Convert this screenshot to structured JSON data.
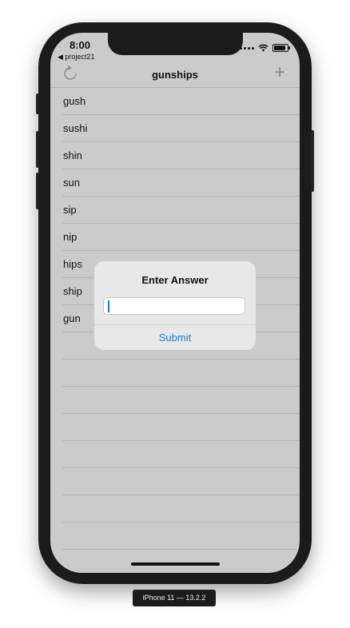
{
  "status": {
    "time": "8:00",
    "back_app": "◀ project21"
  },
  "navbar": {
    "title": "gunships",
    "refresh_icon": "refresh-icon",
    "add_label": "+"
  },
  "words": [
    "gush",
    "sushi",
    "shin",
    "sun",
    "sip",
    "nip",
    "hips",
    "ship",
    "gun",
    "",
    "",
    "",
    "",
    "",
    "",
    "",
    "",
    ""
  ],
  "alert": {
    "title": "Enter Answer",
    "input_value": "",
    "submit_label": "Submit"
  },
  "simulator": {
    "device_label": "iPhone 11 — 13.2.2"
  },
  "colors": {
    "accent": "#1e7ad6",
    "screen_bg": "#cbcbcb",
    "alert_bg": "#e8e8e8"
  }
}
